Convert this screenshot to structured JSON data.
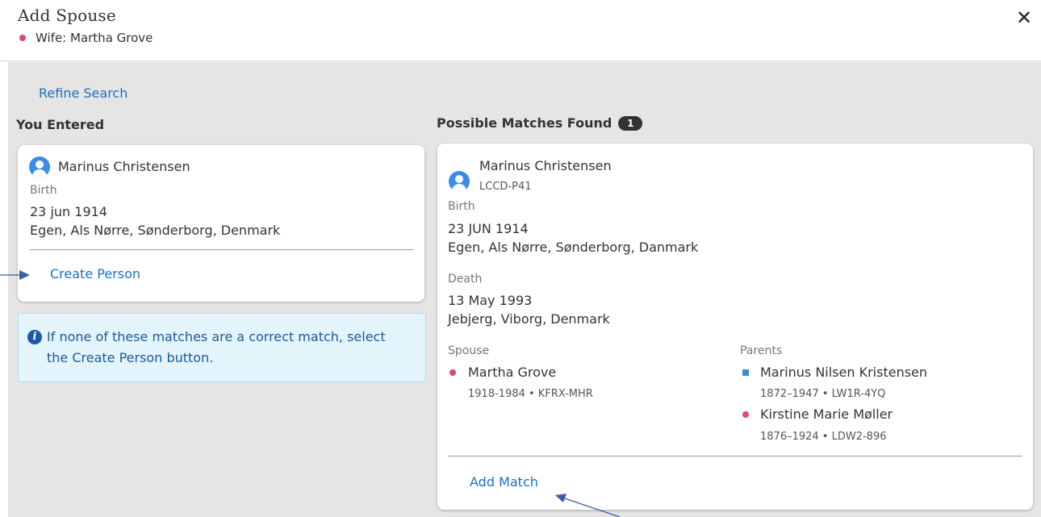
{
  "dialog": {
    "title": "Add Spouse",
    "subtitle": "Wife: Martha Grove",
    "close_symbol": "✕"
  },
  "refine_search": "Refine Search",
  "you_entered": {
    "heading": "You Entered",
    "name": "Marinus Christensen",
    "birth_label": "Birth",
    "birth_date": "23 jun 1914",
    "birth_place": "Egen, Als Nørre, Sønderborg, Denmark",
    "create_person": "Create Person"
  },
  "info": {
    "icon": "info-icon",
    "text": "If none of these matches are a correct match, select the Create Person button."
  },
  "matches": {
    "heading": "Possible Matches Found",
    "count": "1",
    "name": "Marinus Christensen",
    "id": "LCCD-P41",
    "birth_label": "Birth",
    "birth_date": "23 JUN 1914",
    "birth_place": "Egen, Als Nørre, Sønderborg, Danmark",
    "death_label": "Death",
    "death_date": "13 May 1993",
    "death_place": "Jebjerg, Viborg, Denmark",
    "spouse_label": "Spouse",
    "spouse_name": "Martha Grove",
    "spouse_meta": "1918-1984 • KFRX-MHR",
    "parents_label": "Parents",
    "father_name": "Marinus Nilsen Kristensen",
    "father_meta": "1872–1947 • LW1R-4YQ",
    "mother_name": "Kirstine Marie Møller",
    "mother_meta": "1876–1924 • LDW2-896",
    "add_match": "Add Match"
  },
  "colors": {
    "female": "#e0457b",
    "male": "#3b8be8",
    "link": "#1a6fc7",
    "annotation_arrow": "#3a5ea8",
    "panel_bg": "#e6e5e3"
  }
}
